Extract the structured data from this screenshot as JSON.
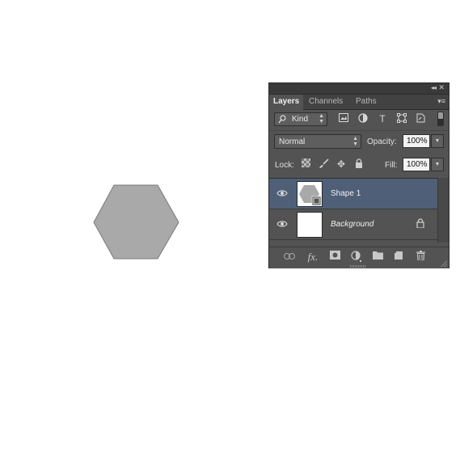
{
  "canvas": {
    "shape_fill": "#a9a9a9",
    "shape_stroke": "#7a7a7a",
    "background": "#ffffff"
  },
  "panel": {
    "tabs": [
      {
        "label": "Layers",
        "active": true
      },
      {
        "label": "Channels",
        "active": false
      },
      {
        "label": "Paths",
        "active": false
      }
    ],
    "filter": {
      "kind_label": "Kind",
      "icons": [
        "image-filter-icon",
        "adjustment-filter-icon",
        "type-filter-icon",
        "shape-filter-icon",
        "smart-object-filter-icon"
      ]
    },
    "blend_mode": "Normal",
    "opacity_label": "Opacity:",
    "opacity_value": "100%",
    "lock_label": "Lock:",
    "fill_label": "Fill:",
    "fill_value": "100%",
    "layers": [
      {
        "name": "Shape 1",
        "selected": true,
        "visible": true,
        "italic": false,
        "locked": false
      },
      {
        "name": "Background",
        "selected": false,
        "visible": true,
        "italic": true,
        "locked": true
      }
    ],
    "colors": {
      "panel_bg": "#535353",
      "selected_row": "#4f5f77",
      "tab_bar": "#424242"
    }
  }
}
